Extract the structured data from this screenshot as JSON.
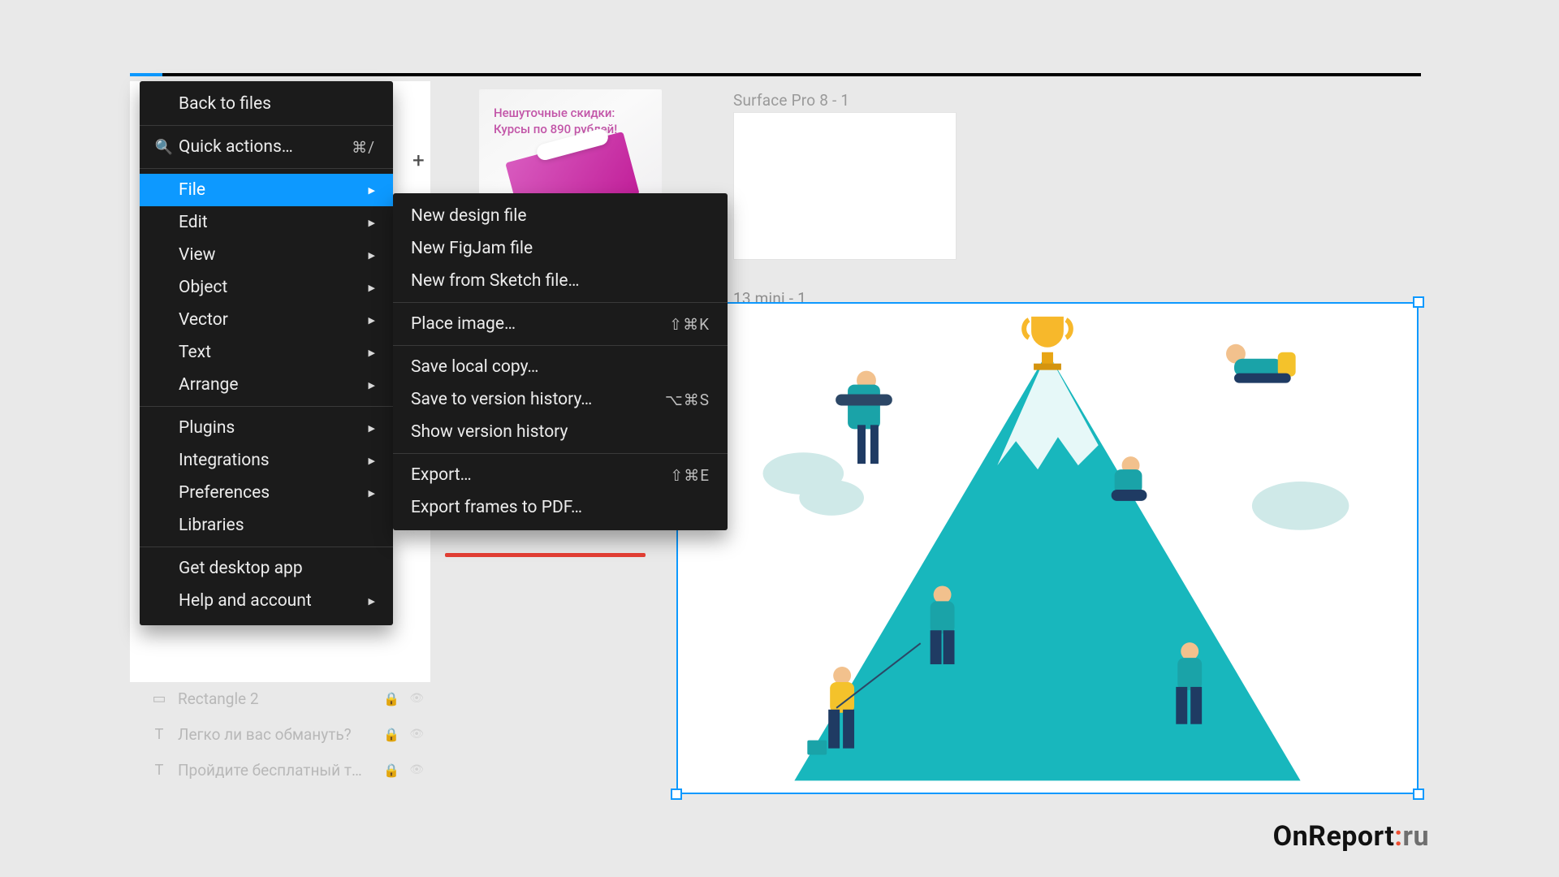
{
  "promo": {
    "line1": "Нешуточные скидки:",
    "line2": "Курсы по 890 рублей!"
  },
  "frames": {
    "surface_label": "Surface Pro 8 - 1",
    "selected_label": "13 mini - 1"
  },
  "mainmenu": {
    "back": "Back to files",
    "quick": "Quick actions…",
    "quick_shortcut": "⌘/",
    "items": [
      {
        "label": "File",
        "active": true,
        "sub": true
      },
      {
        "label": "Edit",
        "sub": true
      },
      {
        "label": "View",
        "sub": true
      },
      {
        "label": "Object",
        "sub": true
      },
      {
        "label": "Vector",
        "sub": true
      },
      {
        "label": "Text",
        "sub": true
      },
      {
        "label": "Arrange",
        "sub": true
      }
    ],
    "group2": [
      {
        "label": "Plugins",
        "sub": true
      },
      {
        "label": "Integrations",
        "sub": true
      },
      {
        "label": "Preferences",
        "sub": true
      },
      {
        "label": "Libraries",
        "sub": false
      }
    ],
    "group3": [
      {
        "label": "Get desktop app",
        "sub": false
      },
      {
        "label": "Help and account",
        "sub": true
      }
    ]
  },
  "submenu": {
    "g1": [
      {
        "label": "New design file"
      },
      {
        "label": "New FigJam file"
      },
      {
        "label": "New from Sketch file…"
      }
    ],
    "g2": [
      {
        "label": "Place image…",
        "shortcut": "⇧⌘K"
      }
    ],
    "g3": [
      {
        "label": "Save local copy…"
      },
      {
        "label": "Save to version history…",
        "shortcut": "⌥⌘S"
      },
      {
        "label": "Show version history"
      }
    ],
    "g4": [
      {
        "label": "Export…",
        "shortcut": "⇧⌘E"
      },
      {
        "label": "Export frames to PDF…"
      }
    ]
  },
  "layers": [
    {
      "icon": "▭",
      "label": "Rectangle 2"
    },
    {
      "icon": "T",
      "label": "Легко ли вас обмануть?"
    },
    {
      "icon": "T",
      "label": "Пройдите бесплатный т…"
    }
  ],
  "watermark": {
    "brand": "OnReport",
    "colon": ":",
    "tld": "ru"
  }
}
